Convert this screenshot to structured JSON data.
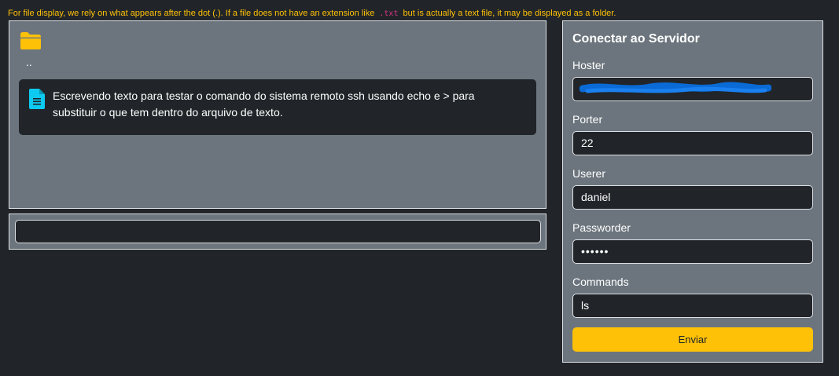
{
  "notice": {
    "before": "For file display, we rely on what appears after the dot (.). If a file does not have an extension like",
    "code": ".txt",
    "after": "but is actually a text file, it may be displayed as a folder."
  },
  "files": {
    "parent_dir": "..",
    "items": [
      {
        "icon": "text-file-icon",
        "name": "Escrevendo texto para testar o comando do sistema remoto ssh usando echo e > para substituir o que tem dentro do arquivo de texto."
      }
    ]
  },
  "command_output": {
    "value": ""
  },
  "connect": {
    "title": "Conectar ao Servidor",
    "fields": {
      "host": {
        "label": "Hoster",
        "value": ""
      },
      "port": {
        "label": "Porter",
        "value": "22"
      },
      "user": {
        "label": "Userer",
        "value": "daniel"
      },
      "password": {
        "label": "Passworder",
        "value": "••••••"
      },
      "command": {
        "label": "Commands",
        "value": "ls"
      }
    },
    "submit_label": "Enviar"
  },
  "colors": {
    "background": "#212529",
    "panel": "#6c757d",
    "accent": "#ffc107",
    "folder": "#ffc107",
    "file_icon": "#0dcaf0",
    "code": "#d63384",
    "redaction": "#0a6bd6"
  }
}
